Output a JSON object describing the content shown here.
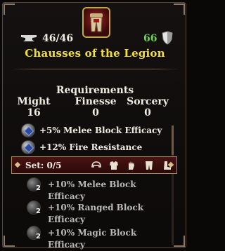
{
  "item": {
    "name": "Chausses of the Legion",
    "weight": "46/46",
    "armor": "66"
  },
  "requirements": {
    "title": "Requirements",
    "stats": [
      {
        "label": "Might",
        "value": "16"
      },
      {
        "label": "Finesse",
        "value": "0"
      },
      {
        "label": "Sorcery",
        "value": "0"
      }
    ]
  },
  "bonuses": [
    {
      "text": "+5% Melee Block Efficacy",
      "icon": "sapphire-orb-icon"
    },
    {
      "text": "+12% Fire Resistance",
      "icon": "sapphire-orb-icon"
    }
  ],
  "set": {
    "label": "Set: 0/5",
    "pieces": [
      "helmet-icon",
      "chest-armor-icon",
      "gauntlets-icon",
      "legs-armor-icon",
      "boots-icon"
    ],
    "bonuses": [
      {
        "count": "2",
        "text": "+10% Melee Block Efficacy"
      },
      {
        "count": "2",
        "text": "+10% Ranged Block Efficacy"
      },
      {
        "count": "2",
        "text": "+10% Magic Block Efficacy"
      }
    ]
  },
  "colors": {
    "title": "#f3df3b",
    "armor": "#6bd05a",
    "set_bar": "#4b1313",
    "frame": "#c3a84b"
  }
}
